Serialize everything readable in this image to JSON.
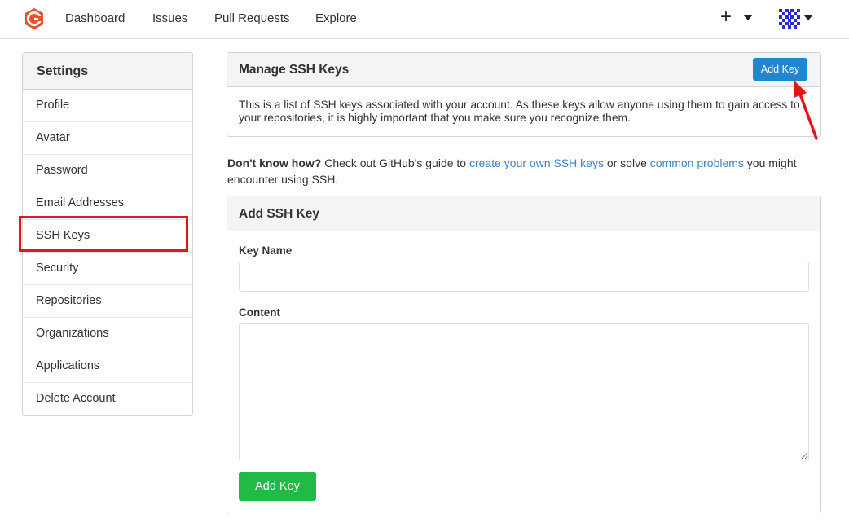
{
  "nav": {
    "items": [
      "Dashboard",
      "Issues",
      "Pull Requests",
      "Explore"
    ],
    "plus": "+"
  },
  "sidebar": {
    "title": "Settings",
    "items": [
      "Profile",
      "Avatar",
      "Password",
      "Email Addresses",
      "SSH Keys",
      "Security",
      "Repositories",
      "Organizations",
      "Applications",
      "Delete Account"
    ],
    "selected": "SSH Keys"
  },
  "manage": {
    "title": "Manage SSH Keys",
    "add_button": "Add Key",
    "description": "This is a list of SSH keys associated with your account. As these keys allow anyone using them to gain access to your repositories, it is highly important that you make sure you recognize them."
  },
  "help": {
    "bold": "Don't know how?",
    "text1": " Check out GitHub's guide to ",
    "link1": "create your own SSH keys",
    "text2": " or solve ",
    "link2": "common problems",
    "text3": " you might encounter using SSH."
  },
  "add": {
    "title": "Add SSH Key",
    "key_name_label": "Key Name",
    "key_name_value": "",
    "content_label": "Content",
    "content_value": "",
    "submit": "Add Key"
  },
  "colors": {
    "primary": "#2185d0",
    "success": "#21ba45",
    "link": "#4183c4",
    "highlight": "#e0161b",
    "logo": "#e8512b"
  }
}
